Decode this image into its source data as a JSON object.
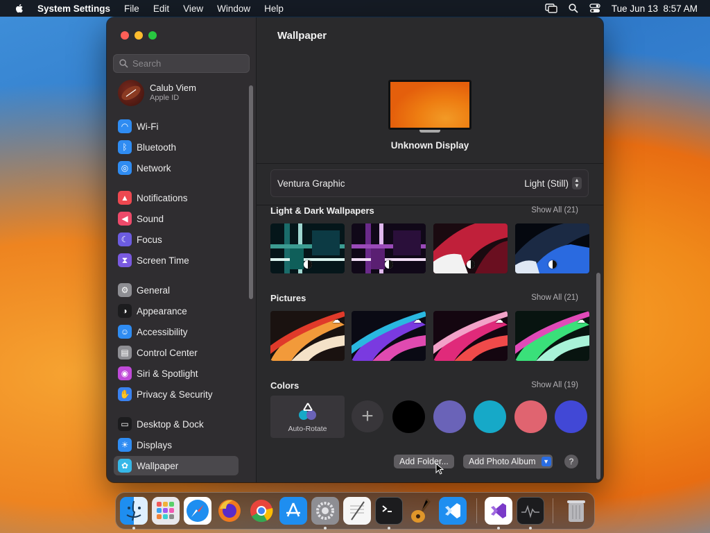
{
  "menubar": {
    "app_name": "System Settings",
    "menus": [
      "File",
      "Edit",
      "View",
      "Window",
      "Help"
    ],
    "clock": "Tue Jun 13  8:57 AM"
  },
  "sidebar": {
    "search_placeholder": "Search",
    "profile": {
      "name": "Calub Viem",
      "subtitle": "Apple ID"
    },
    "items": [
      {
        "label": "Wi-Fi",
        "icon": "wifi-icon",
        "color": "#2f8cf2"
      },
      {
        "label": "Bluetooth",
        "icon": "bluetooth-icon",
        "color": "#2f8cf2"
      },
      {
        "label": "Network",
        "icon": "globe-icon",
        "color": "#2f8cf2"
      },
      {
        "label": "Notifications",
        "icon": "bell-icon",
        "color": "#ee4850"
      },
      {
        "label": "Sound",
        "icon": "speaker-icon",
        "color": "#ee4a6a"
      },
      {
        "label": "Focus",
        "icon": "moon-icon",
        "color": "#6c5ce0"
      },
      {
        "label": "Screen Time",
        "icon": "hourglass-icon",
        "color": "#7a5ae0"
      },
      {
        "label": "General",
        "icon": "gear-icon",
        "color": "#8e8e93"
      },
      {
        "label": "Appearance",
        "icon": "appearance-icon",
        "color": "#1c1c1e"
      },
      {
        "label": "Accessibility",
        "icon": "accessibility-icon",
        "color": "#2f8cf2"
      },
      {
        "label": "Control Center",
        "icon": "toggles-icon",
        "color": "#8e8e93"
      },
      {
        "label": "Siri & Spotlight",
        "icon": "siri-icon",
        "color": "#c04ad8"
      },
      {
        "label": "Privacy & Security",
        "icon": "hand-icon",
        "color": "#3a82f0"
      },
      {
        "label": "Desktop & Dock",
        "icon": "dock-icon",
        "color": "#1c1c1e"
      },
      {
        "label": "Displays",
        "icon": "sun-icon",
        "color": "#2f8cf2"
      },
      {
        "label": "Wallpaper",
        "icon": "flower-icon",
        "color": "#36b8e8"
      }
    ]
  },
  "main": {
    "title": "Wallpaper",
    "display_name": "Unknown Display",
    "current_wallpaper": "Ventura Graphic",
    "appearance_mode": "Light (Still)",
    "sections": {
      "light_dark": {
        "title": "Light & Dark Wallpapers",
        "show_all": "Show All (21)"
      },
      "pictures": {
        "title": "Pictures",
        "show_all": "Show All (21)"
      },
      "colors": {
        "title": "Colors",
        "show_all": "Show All (19)"
      }
    },
    "auto_rotate_label": "Auto-Rotate",
    "color_swatches": [
      "#000000",
      "#6a63b8",
      "#16a9c8",
      "#e06470",
      "#4148d6"
    ],
    "add_folder_label": "Add Folder...",
    "add_photo_album_label": "Add Photo Album",
    "help_label": "?"
  },
  "dock": {
    "apps": [
      "finder-icon",
      "launchpad-icon",
      "safari-icon",
      "firefox-icon",
      "chrome-icon",
      "app-store-icon",
      "system-settings-icon",
      "textedit-icon",
      "terminal-icon",
      "garageband-icon",
      "vscode-icon",
      "visual-studio-icon",
      "activity-monitor-icon",
      "trash-icon"
    ]
  }
}
